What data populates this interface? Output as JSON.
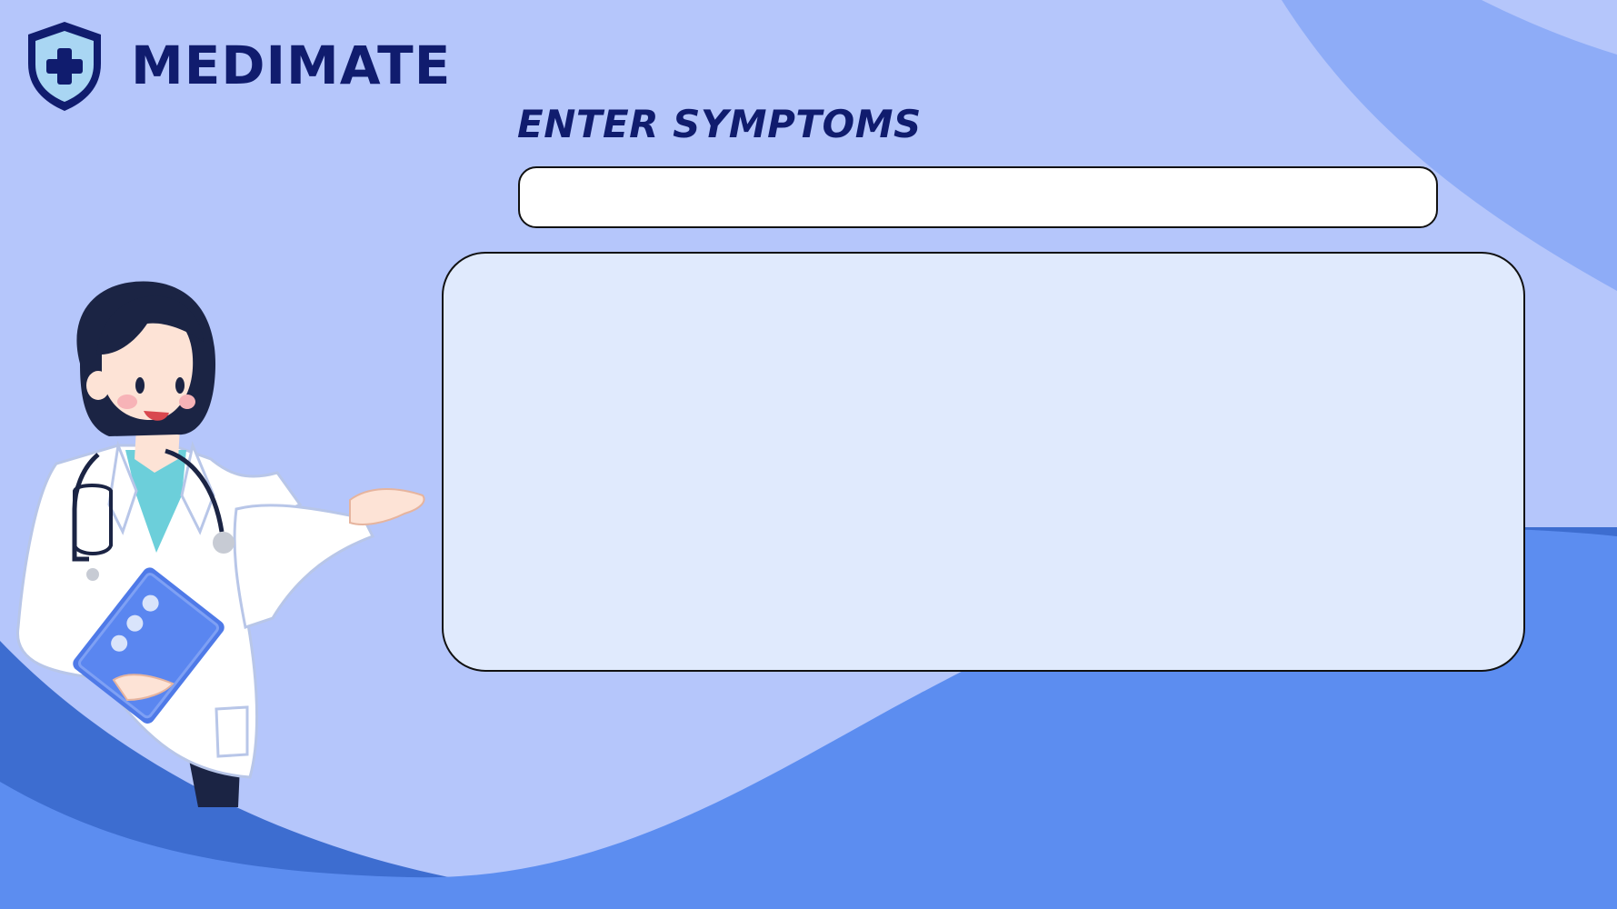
{
  "brand": {
    "name": "MEDIMATE",
    "logo_icon": "shield-plus-icon"
  },
  "symptoms": {
    "title": "ENTER SYMPTOMS",
    "input_value": "",
    "input_placeholder": ""
  },
  "results": {
    "content": ""
  },
  "illustration": {
    "icon": "doctor-illustration"
  },
  "colors": {
    "brand_text": "#101c6e",
    "background": "#b5c6fb",
    "wave_light": "#8eacf7",
    "wave_main": "#5c8df0",
    "wave_dark": "#3d6dd0",
    "panel": "#e0eafd"
  }
}
